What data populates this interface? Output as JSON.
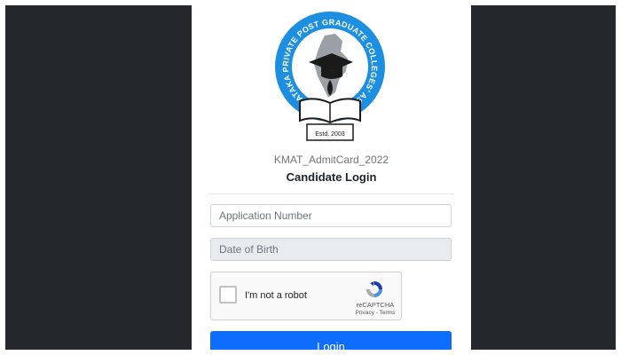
{
  "logo": {
    "ring_text": "KARNATAKA PRIVATE POST GRADUATE COLLEGES' ASSOCIATION",
    "established": "Estd. 2003",
    "colors": {
      "ring": "#1d8fe1",
      "map": "#9aa0a6",
      "ink": "#1a1a1a"
    }
  },
  "document_name": "KMAT_AdmitCard_2022",
  "title": "Candidate Login",
  "form": {
    "application_number": {
      "placeholder": "Application Number",
      "value": ""
    },
    "date_of_birth": {
      "placeholder": "Date of Birth",
      "value": ""
    },
    "captcha": {
      "label": "I'm not a robot",
      "brand": "reCAPTCHA",
      "links": "Privacy - Terms",
      "icon": "recaptcha-icon"
    },
    "login_label": "Login"
  },
  "colors": {
    "primary": "#0d6efd",
    "page_background": "#24272c"
  }
}
